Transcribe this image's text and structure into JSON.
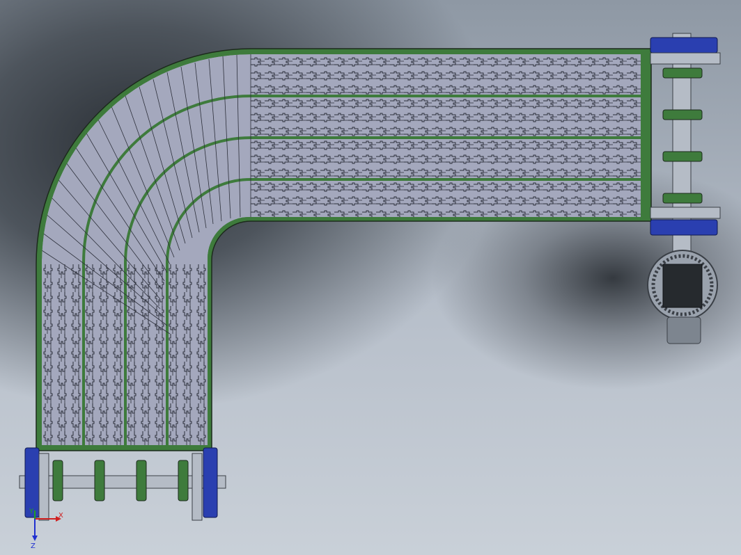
{
  "triad": {
    "x_label": "X",
    "y_label": "Y",
    "z_label": "Z"
  },
  "colors": {
    "frame_green": "#3e7b3c",
    "modules": "#a4a8bd",
    "bearing_blue": "#2a3fb0",
    "shaft_gray": "#b5bcc6",
    "motor_dark": "#262a2e"
  },
  "icons": [
    "coordinate-triad-icon"
  ]
}
